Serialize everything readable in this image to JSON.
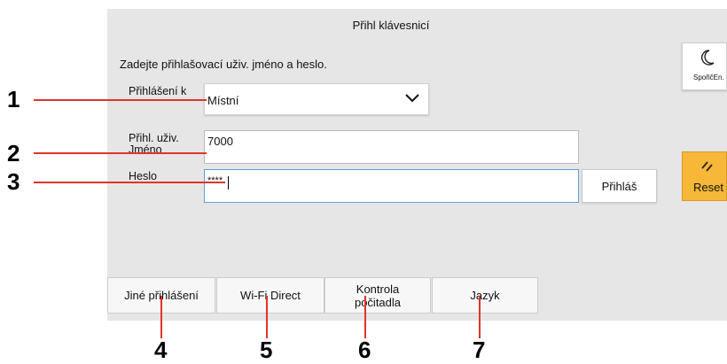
{
  "header": {
    "title": "Přihl klávesnicí"
  },
  "form": {
    "instruction": "Zadejte přihlašovací uživ. jméno a heslo.",
    "login_to_label": "Přihlášení k",
    "login_to_value": "Místní",
    "username_label_line1": "Přihl. uživ.",
    "username_label_line2": "Jméno",
    "username_value": "7000",
    "password_label": "Heslo",
    "password_value": "****",
    "login_button": "Přihláš"
  },
  "side": {
    "sleep_label": "SpořičEn.",
    "reset_label": "Reset"
  },
  "bottom": {
    "other_login": "Jiné přihlášení",
    "wifi_direct": "Wi-Fi Direct",
    "counter_check_line1": "Kontrola",
    "counter_check_line2": "počitadla",
    "language": "Jazyk"
  },
  "callouts": [
    "1",
    "2",
    "3",
    "4",
    "5",
    "6",
    "7"
  ],
  "colors": {
    "callout_line": "#e0342a",
    "reset_button": "#f7b739",
    "panel_bg": "#e6e6e6"
  },
  "icons": {
    "dropdown": "chevron-down-icon",
    "sleep": "moon-icon",
    "reset": "reset-icon"
  }
}
